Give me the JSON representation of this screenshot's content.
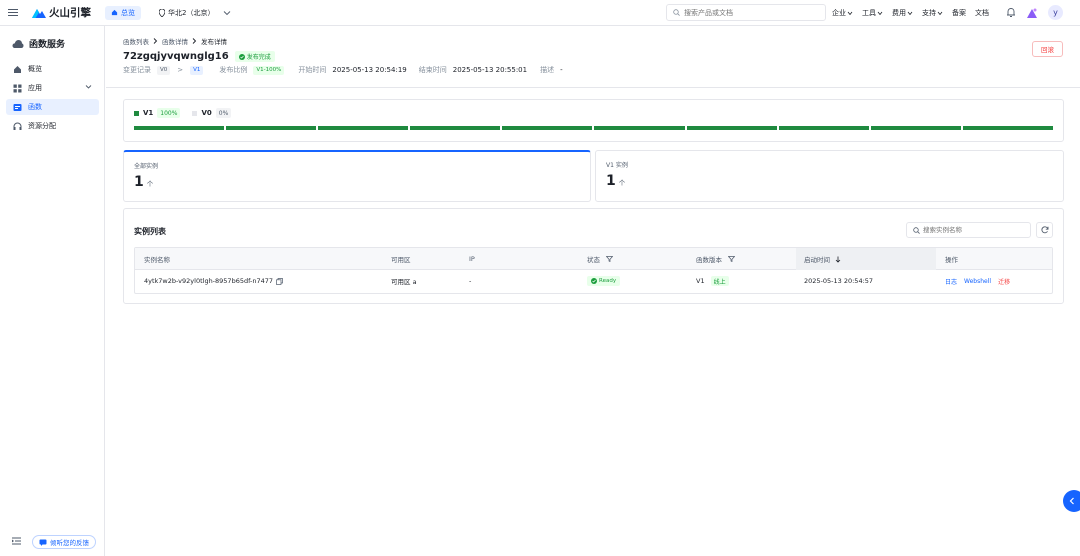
{
  "topbar": {
    "brand": "火山引擎",
    "home_label": "总览",
    "region_label": "华北2（北京）",
    "search_placeholder": "搜索产品或文档",
    "links": [
      "企业",
      "工具",
      "费用",
      "支持",
      "备案",
      "文档"
    ],
    "avatar_letter": "y"
  },
  "sidebar": {
    "title": "函数服务",
    "items": [
      {
        "label": "概览",
        "icon": "home-icon"
      },
      {
        "label": "应用",
        "icon": "grid-icon"
      },
      {
        "label": "函数",
        "icon": "function-icon",
        "active": true
      },
      {
        "label": "资源分配",
        "icon": "headset-icon"
      }
    ],
    "feedback_label": "倾听您的反馈"
  },
  "header": {
    "breadcrumb": [
      "函数列表",
      "函数详情",
      "发布详情"
    ],
    "function_name": "72zgqjyvqwnglg16",
    "status": "发布完成",
    "change_label": "变更记录",
    "from_version": "V0",
    "arrow": ">",
    "to_version": "V1",
    "ratio_label": "发布比例",
    "ratio_value": "V1-100%",
    "start_label": "开始时间",
    "start_time": "2025-05-13 20:54:19",
    "end_label": "结束时间",
    "end_time": "2025-05-13 20:55:01",
    "desc_label": "描述",
    "desc_value": "-",
    "rollback_label": "回滚"
  },
  "progress": {
    "versions": [
      {
        "name": "V1",
        "percent": "100%"
      },
      {
        "name": "V0",
        "percent": "0%"
      }
    ],
    "fill_fraction": 1.0,
    "segments": 10,
    "accent": "#1f8a3f"
  },
  "counts": [
    {
      "label": "全部实例",
      "value": "1",
      "unit": "个",
      "selected": true
    },
    {
      "label": "V1 实例",
      "value": "1",
      "unit": "个",
      "selected": false
    }
  ],
  "instances": {
    "title": "实例列表",
    "search_placeholder": "搜索实例名称",
    "columns": [
      "实例名称",
      "可用区",
      "IP",
      "状态",
      "函数版本",
      "启动时间",
      "操作"
    ],
    "rows": [
      {
        "name": "4ytk7w2b-v92yl0tlgh-8957b65df-n7477",
        "zone": "可用区 a",
        "ip": "-",
        "status": "Ready",
        "version": "V1",
        "version_tag": "线上",
        "start_time": "2025-05-13 20:54:57",
        "actions": [
          "日志",
          "Webshell",
          "迁移"
        ]
      }
    ]
  },
  "colors": {
    "primary": "#1664ff",
    "success": "#1a9d3c",
    "danger": "#f53f3f"
  }
}
